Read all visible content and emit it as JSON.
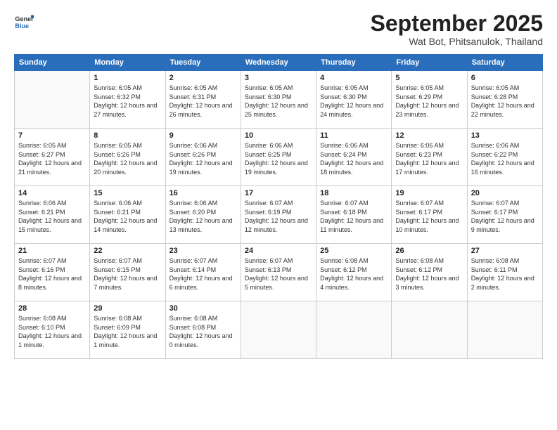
{
  "header": {
    "logo_general": "General",
    "logo_blue": "Blue",
    "month_title": "September 2025",
    "subtitle": "Wat Bot, Phitsanulok, Thailand"
  },
  "weekdays": [
    "Sunday",
    "Monday",
    "Tuesday",
    "Wednesday",
    "Thursday",
    "Friday",
    "Saturday"
  ],
  "weeks": [
    [
      {
        "day": "",
        "empty": true
      },
      {
        "day": "1",
        "sunrise": "6:05 AM",
        "sunset": "6:32 PM",
        "daylight": "12 hours and 27 minutes."
      },
      {
        "day": "2",
        "sunrise": "6:05 AM",
        "sunset": "6:31 PM",
        "daylight": "12 hours and 26 minutes."
      },
      {
        "day": "3",
        "sunrise": "6:05 AM",
        "sunset": "6:30 PM",
        "daylight": "12 hours and 25 minutes."
      },
      {
        "day": "4",
        "sunrise": "6:05 AM",
        "sunset": "6:30 PM",
        "daylight": "12 hours and 24 minutes."
      },
      {
        "day": "5",
        "sunrise": "6:05 AM",
        "sunset": "6:29 PM",
        "daylight": "12 hours and 23 minutes."
      },
      {
        "day": "6",
        "sunrise": "6:05 AM",
        "sunset": "6:28 PM",
        "daylight": "12 hours and 22 minutes."
      }
    ],
    [
      {
        "day": "7",
        "sunrise": "6:05 AM",
        "sunset": "6:27 PM",
        "daylight": "12 hours and 21 minutes."
      },
      {
        "day": "8",
        "sunrise": "6:05 AM",
        "sunset": "6:26 PM",
        "daylight": "12 hours and 20 minutes."
      },
      {
        "day": "9",
        "sunrise": "6:06 AM",
        "sunset": "6:26 PM",
        "daylight": "12 hours and 19 minutes."
      },
      {
        "day": "10",
        "sunrise": "6:06 AM",
        "sunset": "6:25 PM",
        "daylight": "12 hours and 19 minutes."
      },
      {
        "day": "11",
        "sunrise": "6:06 AM",
        "sunset": "6:24 PM",
        "daylight": "12 hours and 18 minutes."
      },
      {
        "day": "12",
        "sunrise": "6:06 AM",
        "sunset": "6:23 PM",
        "daylight": "12 hours and 17 minutes."
      },
      {
        "day": "13",
        "sunrise": "6:06 AM",
        "sunset": "6:22 PM",
        "daylight": "12 hours and 16 minutes."
      }
    ],
    [
      {
        "day": "14",
        "sunrise": "6:06 AM",
        "sunset": "6:21 PM",
        "daylight": "12 hours and 15 minutes."
      },
      {
        "day": "15",
        "sunrise": "6:06 AM",
        "sunset": "6:21 PM",
        "daylight": "12 hours and 14 minutes."
      },
      {
        "day": "16",
        "sunrise": "6:06 AM",
        "sunset": "6:20 PM",
        "daylight": "12 hours and 13 minutes."
      },
      {
        "day": "17",
        "sunrise": "6:07 AM",
        "sunset": "6:19 PM",
        "daylight": "12 hours and 12 minutes."
      },
      {
        "day": "18",
        "sunrise": "6:07 AM",
        "sunset": "6:18 PM",
        "daylight": "12 hours and 11 minutes."
      },
      {
        "day": "19",
        "sunrise": "6:07 AM",
        "sunset": "6:17 PM",
        "daylight": "12 hours and 10 minutes."
      },
      {
        "day": "20",
        "sunrise": "6:07 AM",
        "sunset": "6:17 PM",
        "daylight": "12 hours and 9 minutes."
      }
    ],
    [
      {
        "day": "21",
        "sunrise": "6:07 AM",
        "sunset": "6:16 PM",
        "daylight": "12 hours and 8 minutes."
      },
      {
        "day": "22",
        "sunrise": "6:07 AM",
        "sunset": "6:15 PM",
        "daylight": "12 hours and 7 minutes."
      },
      {
        "day": "23",
        "sunrise": "6:07 AM",
        "sunset": "6:14 PM",
        "daylight": "12 hours and 6 minutes."
      },
      {
        "day": "24",
        "sunrise": "6:07 AM",
        "sunset": "6:13 PM",
        "daylight": "12 hours and 5 minutes."
      },
      {
        "day": "25",
        "sunrise": "6:08 AM",
        "sunset": "6:12 PM",
        "daylight": "12 hours and 4 minutes."
      },
      {
        "day": "26",
        "sunrise": "6:08 AM",
        "sunset": "6:12 PM",
        "daylight": "12 hours and 3 minutes."
      },
      {
        "day": "27",
        "sunrise": "6:08 AM",
        "sunset": "6:11 PM",
        "daylight": "12 hours and 2 minutes."
      }
    ],
    [
      {
        "day": "28",
        "sunrise": "6:08 AM",
        "sunset": "6:10 PM",
        "daylight": "12 hours and 1 minute."
      },
      {
        "day": "29",
        "sunrise": "6:08 AM",
        "sunset": "6:09 PM",
        "daylight": "12 hours and 1 minute."
      },
      {
        "day": "30",
        "sunrise": "6:08 AM",
        "sunset": "6:08 PM",
        "daylight": "12 hours and 0 minutes."
      },
      {
        "day": "",
        "empty": true
      },
      {
        "day": "",
        "empty": true
      },
      {
        "day": "",
        "empty": true
      },
      {
        "day": "",
        "empty": true
      }
    ]
  ]
}
